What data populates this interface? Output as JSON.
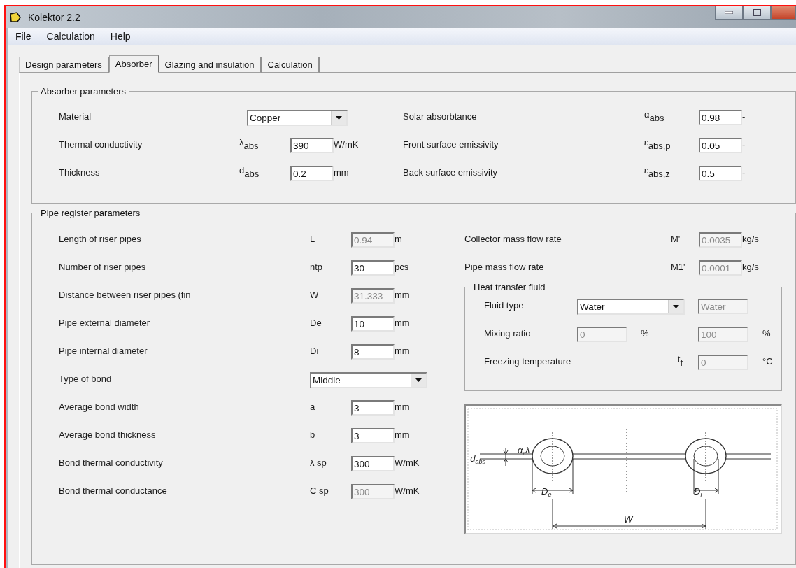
{
  "window": {
    "title": "Kolektor 2.2"
  },
  "menu": [
    "File",
    "Calculation",
    "Help"
  ],
  "tabs": [
    {
      "label": "Design parameters",
      "selected": false
    },
    {
      "label": "Absorber",
      "selected": true
    },
    {
      "label": "Glazing and insulation",
      "selected": false
    },
    {
      "label": "Calculation",
      "selected": false
    }
  ],
  "absorber_parameters": {
    "title": "Absorber parameters",
    "left_rows": [
      {
        "kind": "combo",
        "label": "Material",
        "value": "Copper"
      },
      {
        "kind": "field",
        "label": "Thermal conductivity",
        "symbol": "λ$_{abs}$",
        "value": "390",
        "unit": "W/mK",
        "disabled": false
      },
      {
        "kind": "field",
        "label": "Thickness",
        "symbol": "d$_{abs}$",
        "value": "0.2",
        "unit": "mm",
        "disabled": false
      }
    ],
    "right_rows": [
      {
        "kind": "field",
        "label": "Solar absorbtance",
        "symbol": "α$_{abs}$",
        "value": "0.98",
        "unit": "-",
        "disabled": false
      },
      {
        "kind": "field",
        "label": "Front surface emissivity",
        "symbol": "ε$_{abs,p}$",
        "value": "0.05",
        "unit": "-",
        "disabled": false
      },
      {
        "kind": "field",
        "label": "Back surface emissivity",
        "symbol": "ε$_{abs,z}$",
        "value": "0.5",
        "unit": "-",
        "disabled": false
      }
    ]
  },
  "pipe_register_parameters": {
    "title": "Pipe register parameters",
    "rows": [
      {
        "kind": "field",
        "label": "Length of riser pipes",
        "symbol": "L",
        "value": "0.94",
        "unit": "m",
        "disabled": true
      },
      {
        "kind": "field",
        "label": "Number of riser pipes",
        "symbol": "ntp",
        "value": "30",
        "unit": "pcs",
        "disabled": false
      },
      {
        "kind": "field",
        "label": "Distance between riser pipes (fin",
        "symbol": "W",
        "value": "31.333",
        "unit": "mm",
        "disabled": true
      },
      {
        "kind": "field",
        "label": "Pipe external diameter",
        "symbol": "De",
        "value": "10",
        "unit": "mm",
        "disabled": false
      },
      {
        "kind": "field",
        "label": "Pipe internal diameter",
        "symbol": "Di",
        "value": "8",
        "unit": "mm",
        "disabled": false
      },
      {
        "kind": "combo",
        "label": "Type of bond",
        "value": "Middle"
      },
      {
        "kind": "field",
        "label": "Average bond width",
        "symbol": "a",
        "value": "3",
        "unit": "mm",
        "disabled": false
      },
      {
        "kind": "field",
        "label": "Average bond thickness",
        "symbol": "b",
        "value": "3",
        "unit": "mm",
        "disabled": false
      },
      {
        "kind": "field",
        "label": "Bond thermal conductivity",
        "symbol": "λ sp",
        "value": "300",
        "unit": "W/mK",
        "disabled": false
      },
      {
        "kind": "field",
        "label": "Bond thermal conductance",
        "symbol": "C sp",
        "value": "300",
        "unit": "W/mK",
        "disabled": true
      }
    ],
    "flow_rows": [
      {
        "kind": "field",
        "label": "Collector mass flow rate",
        "symbol": "M'",
        "value": "0.0035",
        "unit": "kg/s",
        "disabled": true
      },
      {
        "kind": "field",
        "label": "Pipe mass flow rate",
        "symbol": "M1'",
        "value": "0.0001",
        "unit": "kg/s",
        "disabled": true
      }
    ],
    "heat_transfer_fluid": {
      "title": "Heat transfer fluid",
      "fluid_type": {
        "label": "Fluid type",
        "value": "Water",
        "name_field": {
          "value": "Water",
          "disabled": true
        }
      },
      "mixing_ratio": {
        "label": "Mixing ratio",
        "first": {
          "value": "0",
          "disabled": true
        },
        "first_unit": "%",
        "second": {
          "value": "100",
          "disabled": true
        },
        "second_unit": "%"
      },
      "freezing_temperature": {
        "label": "Freezing temperature",
        "symbol": "t$_{f}$",
        "field": {
          "value": "0",
          "disabled": true
        },
        "unit": "°C"
      }
    },
    "diagram": {
      "labels": [
        {
          "text": "d",
          "sub": "abs"
        },
        {
          "text": "α,λ"
        },
        {
          "text": "D",
          "sub": "e"
        },
        {
          "text": "D",
          "sub": "i"
        },
        {
          "text": "W"
        }
      ]
    }
  }
}
